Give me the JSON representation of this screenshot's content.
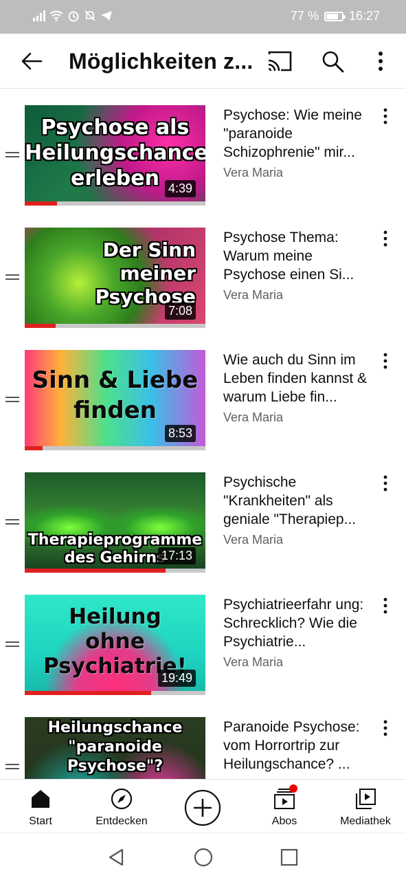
{
  "status_bar": {
    "battery": "77 %",
    "time": "16:27"
  },
  "header": {
    "title": "Möglichkeiten z..."
  },
  "videos": [
    {
      "thumb_text": "Psychose als\nHeilungschance\nerleben",
      "duration": "4:39",
      "progress": 0.18,
      "title": "Psychose: Wie meine \"paranoide Schizophrenie\" mir...",
      "channel": "Vera Maria"
    },
    {
      "thumb_text": "Der Sinn\nmeiner\nPsychose",
      "duration": "7:08",
      "progress": 0.17,
      "title": "Psychose Thema: Warum meine Psychose einen Si...",
      "channel": "Vera Maria"
    },
    {
      "thumb_text": "Sinn & Liebe\nfinden",
      "duration": "8:53",
      "progress": 0.1,
      "title": "Wie auch du Sinn im Leben finden kannst & warum Liebe fin...",
      "channel": "Vera Maria"
    },
    {
      "thumb_text": "Therapieprogramme\ndes Gehirns",
      "duration": "17:13",
      "progress": 0.78,
      "title": "Psychische \"Krankheiten\" als geniale \"Therapiep...",
      "channel": "Vera Maria"
    },
    {
      "thumb_text": "Heilung\nohne\nPsychiatrie!",
      "duration": "19:49",
      "progress": 0.7,
      "title": "Psychiatrieerfahr ung: Schrecklich? Wie die Psychiatrie...",
      "channel": "Vera Maria"
    },
    {
      "thumb_text": "Heilungschance\n\"paranoide Psychose\"?",
      "duration": "",
      "progress": 0,
      "title": "Paranoide Psychose: vom Horrortrip zur Heilungschance? ...",
      "channel": ""
    }
  ],
  "bottom_nav": {
    "start": "Start",
    "entdecken": "Entdecken",
    "abos": "Abos",
    "mediathek": "Mediathek"
  },
  "colors": {
    "accent": "#e02020",
    "text": "#0f0f0f",
    "secondary": "#606060",
    "statusbar": "#bdbdbd"
  }
}
